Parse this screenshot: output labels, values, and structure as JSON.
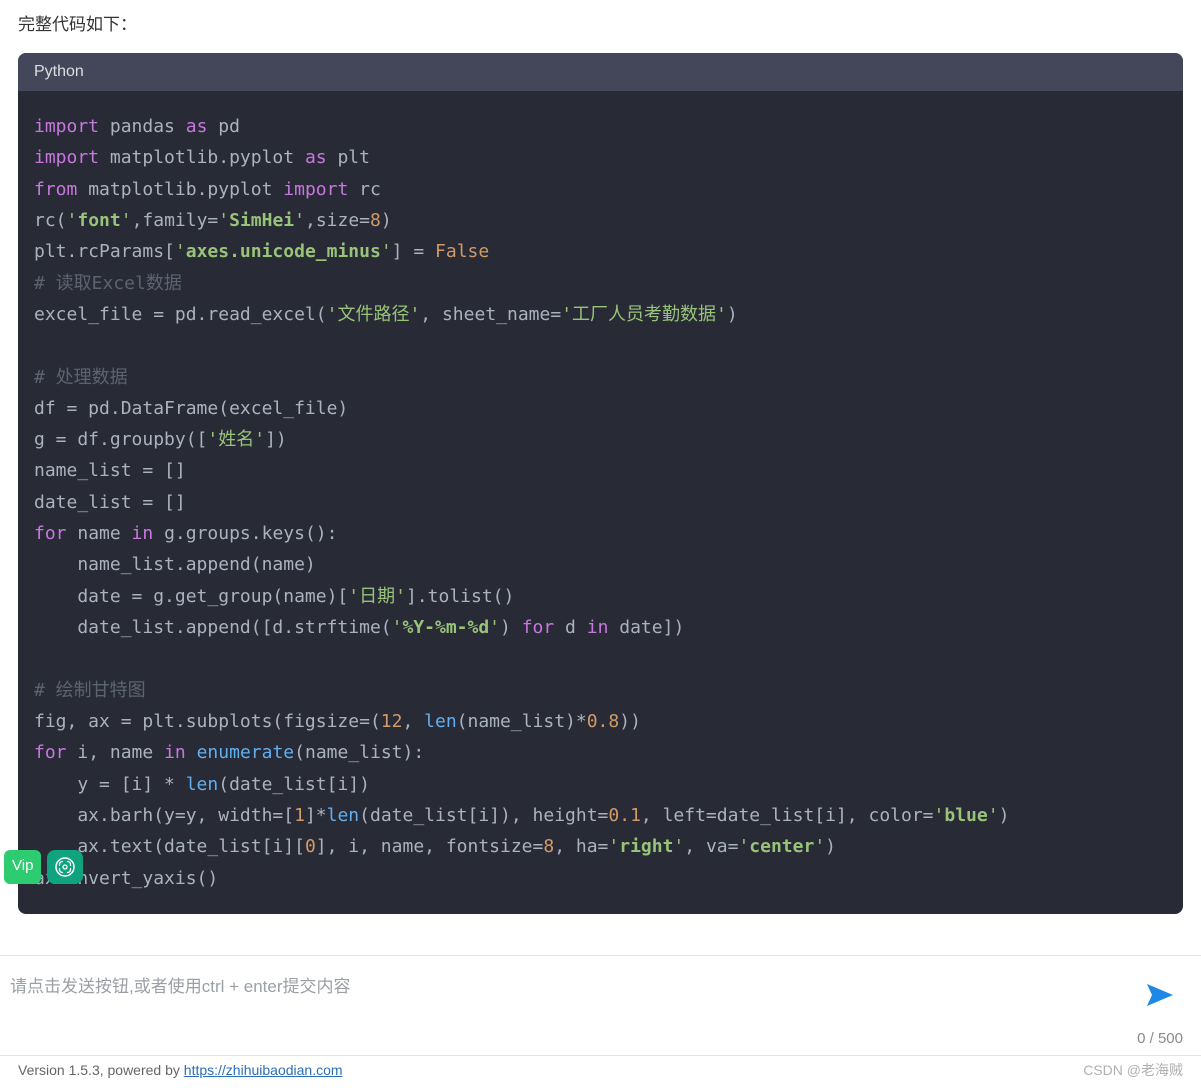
{
  "intro_text": "完整代码如下：",
  "code": {
    "language_label": "Python",
    "tokens": [
      [
        [
          "import",
          "kw"
        ],
        [
          " pandas ",
          "id"
        ],
        [
          "as",
          "kw"
        ],
        [
          " pd",
          "id"
        ]
      ],
      [
        [
          "import",
          "kw"
        ],
        [
          " matplotlib.pyplot ",
          "id"
        ],
        [
          "as",
          "kw"
        ],
        [
          " plt",
          "id"
        ]
      ],
      [
        [
          "from",
          "kw"
        ],
        [
          " matplotlib.pyplot ",
          "id"
        ],
        [
          "import",
          "kw"
        ],
        [
          " rc",
          "id"
        ]
      ],
      [
        [
          "rc(",
          "id"
        ],
        [
          "'",
          "str"
        ],
        [
          "font",
          "strb"
        ],
        [
          "'",
          "str"
        ],
        [
          ",family=",
          "id"
        ],
        [
          "'",
          "str"
        ],
        [
          "SimHei",
          "strb"
        ],
        [
          "'",
          "str"
        ],
        [
          ",size=",
          "id"
        ],
        [
          "8",
          "num"
        ],
        [
          ")",
          "id"
        ]
      ],
      [
        [
          "plt.rcParams[",
          "id"
        ],
        [
          "'",
          "str"
        ],
        [
          "axes.unicode_minus",
          "strb"
        ],
        [
          "'",
          "str"
        ],
        [
          "] = ",
          "id"
        ],
        [
          "False",
          "bool"
        ]
      ],
      [
        [
          "# 读取Excel数据",
          "cmt"
        ]
      ],
      [
        [
          "excel_file = pd.read_excel(",
          "id"
        ],
        [
          "'文件路径'",
          "str"
        ],
        [
          ", sheet_name=",
          "id"
        ],
        [
          "'工厂人员考勤数据'",
          "str"
        ],
        [
          ")",
          "id"
        ]
      ],
      [],
      [
        [
          "# 处理数据",
          "cmt"
        ]
      ],
      [
        [
          "df = pd.DataFrame(excel_file)",
          "id"
        ]
      ],
      [
        [
          "g = df.groupby([",
          "id"
        ],
        [
          "'姓名'",
          "str"
        ],
        [
          "])",
          "id"
        ]
      ],
      [
        [
          "name_list = []",
          "id"
        ]
      ],
      [
        [
          "date_list = []",
          "id"
        ]
      ],
      [
        [
          "for",
          "kw"
        ],
        [
          " name ",
          "id"
        ],
        [
          "in",
          "kw"
        ],
        [
          " g.groups.keys():",
          "id"
        ]
      ],
      [
        [
          "    name_list.append(name)",
          "id"
        ]
      ],
      [
        [
          "    date = g.get_group(name)[",
          "id"
        ],
        [
          "'日期'",
          "str"
        ],
        [
          "].tolist()",
          "id"
        ]
      ],
      [
        [
          "    date_list.append([d.strftime(",
          "id"
        ],
        [
          "'",
          "str"
        ],
        [
          "%Y-%m-%d",
          "strb"
        ],
        [
          "'",
          "str"
        ],
        [
          ") ",
          "id"
        ],
        [
          "for",
          "kw"
        ],
        [
          " d ",
          "id"
        ],
        [
          "in",
          "kw"
        ],
        [
          " date])",
          "id"
        ]
      ],
      [],
      [
        [
          "# 绘制甘特图",
          "cmt"
        ]
      ],
      [
        [
          "fig, ax = plt.subplots(figsize=(",
          "id"
        ],
        [
          "12",
          "num"
        ],
        [
          ", ",
          "id"
        ],
        [
          "len",
          "fn"
        ],
        [
          "(name_list)*",
          "id"
        ],
        [
          "0.8",
          "num"
        ],
        [
          "))",
          "id"
        ]
      ],
      [
        [
          "for",
          "kw"
        ],
        [
          " i, name ",
          "id"
        ],
        [
          "in",
          "kw"
        ],
        [
          " ",
          "id"
        ],
        [
          "enumerate",
          "fn"
        ],
        [
          "(name_list):",
          "id"
        ]
      ],
      [
        [
          "    y = [i] * ",
          "id"
        ],
        [
          "len",
          "fn"
        ],
        [
          "(date_list[i])",
          "id"
        ]
      ],
      [
        [
          "    ax.barh(y=y, width=[",
          "id"
        ],
        [
          "1",
          "num"
        ],
        [
          "]*",
          "id"
        ],
        [
          "len",
          "fn"
        ],
        [
          "(date_list[i]), height=",
          "id"
        ],
        [
          "0.1",
          "num"
        ],
        [
          ", left=date_list[i], color=",
          "id"
        ],
        [
          "'",
          "str"
        ],
        [
          "blue",
          "strb"
        ],
        [
          "'",
          "str"
        ],
        [
          ")",
          "id"
        ]
      ],
      [
        [
          "    ax.text(date_list[i][",
          "id"
        ],
        [
          "0",
          "num"
        ],
        [
          "], i, name, fontsize=",
          "id"
        ],
        [
          "8",
          "num"
        ],
        [
          ", ha=",
          "id"
        ],
        [
          "'",
          "str"
        ],
        [
          "right",
          "strb"
        ],
        [
          "'",
          "str"
        ],
        [
          ", va=",
          "id"
        ],
        [
          "'",
          "str"
        ],
        [
          "center",
          "strb"
        ],
        [
          "'",
          "str"
        ],
        [
          ")",
          "id"
        ]
      ],
      [
        [
          "ax.invert_yaxis()",
          "id"
        ]
      ]
    ]
  },
  "input": {
    "placeholder": "请点击发送按钮,或者使用ctrl + enter提交内容",
    "counter": "0 / 500"
  },
  "footer": {
    "version_prefix": "Version 1.5.3, powered by ",
    "link_text": "https://zhihuibaodian.com",
    "watermark": "CSDN @老海贼"
  },
  "badges": {
    "vip_label": "Vip"
  }
}
